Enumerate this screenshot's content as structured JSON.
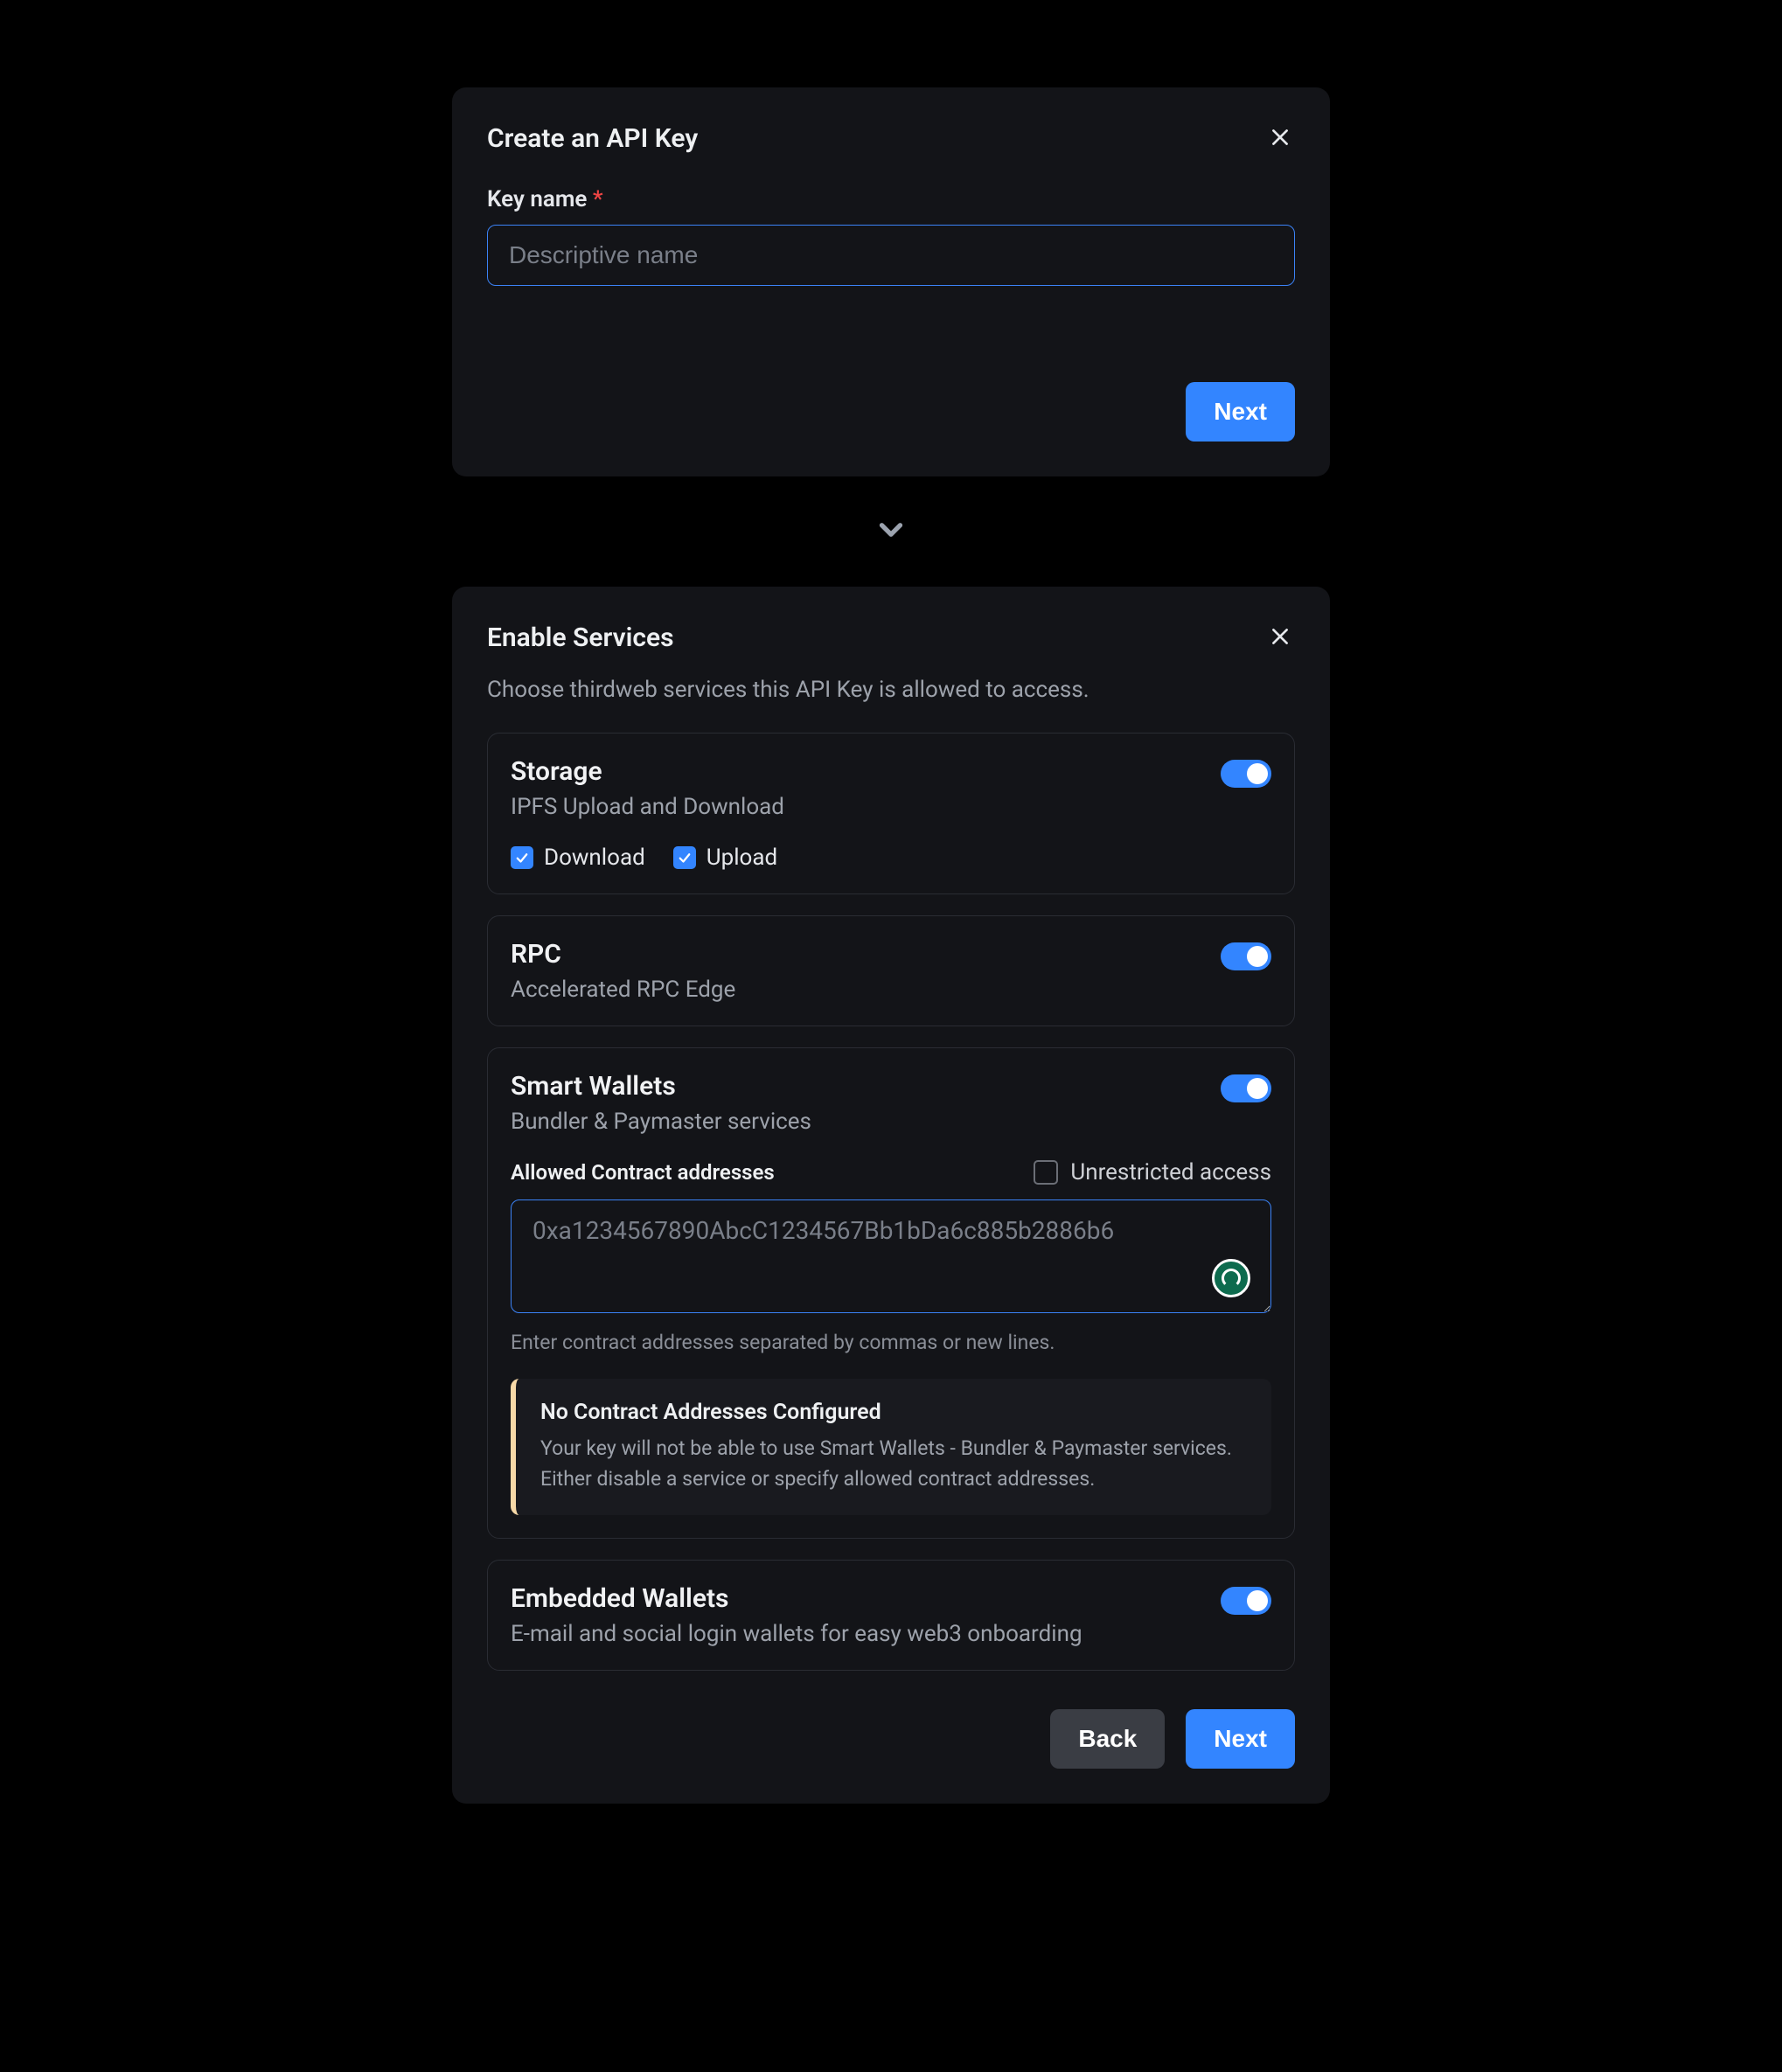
{
  "modal1": {
    "title": "Create an API Key",
    "key_name_label": "Key name",
    "key_name_placeholder": "Descriptive name",
    "key_name_value": "",
    "next_label": "Next"
  },
  "modal2": {
    "title": "Enable Services",
    "description": "Choose thirdweb services this API Key is allowed to access.",
    "services": {
      "storage": {
        "title": "Storage",
        "subtitle": "IPFS Upload and Download",
        "enabled": true,
        "download_label": "Download",
        "download_checked": true,
        "upload_label": "Upload",
        "upload_checked": true
      },
      "rpc": {
        "title": "RPC",
        "subtitle": "Accelerated RPC Edge",
        "enabled": true
      },
      "smart_wallets": {
        "title": "Smart Wallets",
        "subtitle": "Bundler & Paymaster services",
        "enabled": true,
        "allowed_label": "Allowed Contract addresses",
        "unrestricted_label": "Unrestricted access",
        "unrestricted_checked": false,
        "textarea_placeholder": "0xa1234567890AbcC1234567Bb1bDa6c885b2886b6",
        "textarea_value": "",
        "help_text": "Enter contract addresses separated by commas or new lines.",
        "alert_title": "No Contract Addresses Configured",
        "alert_text": "Your key will not be able to use Smart Wallets - Bundler & Paymaster services. Either disable a service or specify allowed contract addresses."
      },
      "embedded_wallets": {
        "title": "Embedded Wallets",
        "subtitle": "E-mail and social login wallets for easy web3 onboarding",
        "enabled": true
      }
    },
    "back_label": "Back",
    "next_label": "Next"
  }
}
